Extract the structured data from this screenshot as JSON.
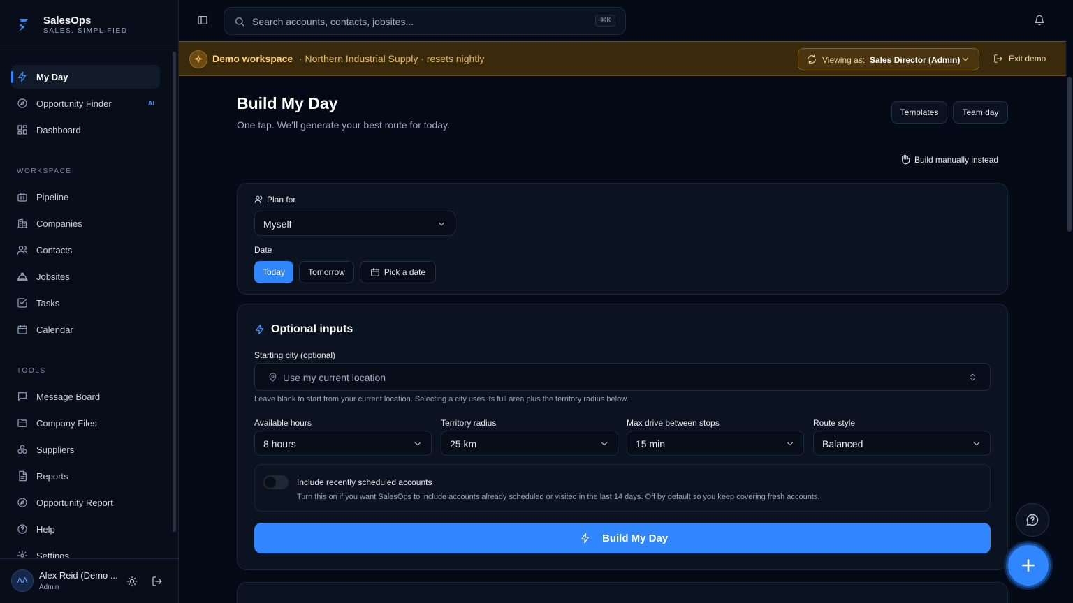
{
  "brand": {
    "name": "SalesOps",
    "tagline": "SALES. SIMPLIFIED"
  },
  "nav": {
    "primary": [
      {
        "label": "My Day",
        "icon": "bolt-icon",
        "active": true
      },
      {
        "label": "Opportunity Finder",
        "icon": "compass-icon",
        "badge": "AI"
      },
      {
        "label": "Dashboard",
        "icon": "dashboard-icon"
      }
    ],
    "workspace_label": "WORKSPACE",
    "workspace": [
      {
        "label": "Pipeline",
        "icon": "pipeline-icon"
      },
      {
        "label": "Companies",
        "icon": "building-icon"
      },
      {
        "label": "Contacts",
        "icon": "users-icon"
      },
      {
        "label": "Jobsites",
        "icon": "hardhat-icon"
      },
      {
        "label": "Tasks",
        "icon": "checkbox-icon"
      },
      {
        "label": "Calendar",
        "icon": "calendar-icon"
      }
    ],
    "tools_label": "TOOLS",
    "tools": [
      {
        "label": "Message Board",
        "icon": "message-icon"
      },
      {
        "label": "Company Files",
        "icon": "folder-icon"
      },
      {
        "label": "Suppliers",
        "icon": "boxes-icon"
      },
      {
        "label": "Reports",
        "icon": "report-icon"
      },
      {
        "label": "Opportunity Report",
        "icon": "compass-icon"
      },
      {
        "label": "Help",
        "icon": "help-icon"
      },
      {
        "label": "Settings",
        "icon": "gear-icon"
      }
    ]
  },
  "user": {
    "initials": "AA",
    "name": "Alex Reid (Demo ...",
    "role": "Admin"
  },
  "topbar": {
    "search_placeholder": "Search accounts, contacts, jobsites...",
    "shortcut": "⌘K"
  },
  "banner": {
    "title": "Demo workspace",
    "org": "· Northern Industrial Supply · resets nightly",
    "viewing_label": "Viewing as:",
    "viewing_value": "Sales Director (Admin)",
    "exit_label": "Exit demo"
  },
  "page": {
    "title": "Build My Day",
    "subtitle": "One tap. We'll generate your best route for today.",
    "templates_label": "Templates",
    "team_day_label": "Team day",
    "manual_label": "Build manually instead"
  },
  "plan": {
    "plan_for_label": "Plan for",
    "plan_for_value": "Myself",
    "date_label": "Date",
    "date_options": [
      "Today",
      "Tomorrow",
      "Pick a date"
    ],
    "date_selected": "Today"
  },
  "optional": {
    "title": "Optional inputs",
    "city_label": "Starting city (optional)",
    "city_placeholder": "Use my current location",
    "city_help": "Leave blank to start from your current location. Selecting a city uses its full area plus the territory radius below.",
    "hours_label": "Available hours",
    "hours_value": "8 hours",
    "radius_label": "Territory radius",
    "radius_value": "25 km",
    "drive_label": "Max drive between stops",
    "drive_value": "15 min",
    "style_label": "Route style",
    "style_value": "Balanced",
    "toggle_title": "Include recently scheduled accounts",
    "toggle_desc": "Turn this on if you want SalesOps to include accounts already scheduled or visited in the last 14 days. Off by default so you keep covering fresh accounts.",
    "toggle_on": false,
    "build_label": "Build My Day"
  },
  "colors": {
    "accent": "#2f86ff",
    "banner_bg": "#3a2a0c",
    "background": "#050b16"
  }
}
